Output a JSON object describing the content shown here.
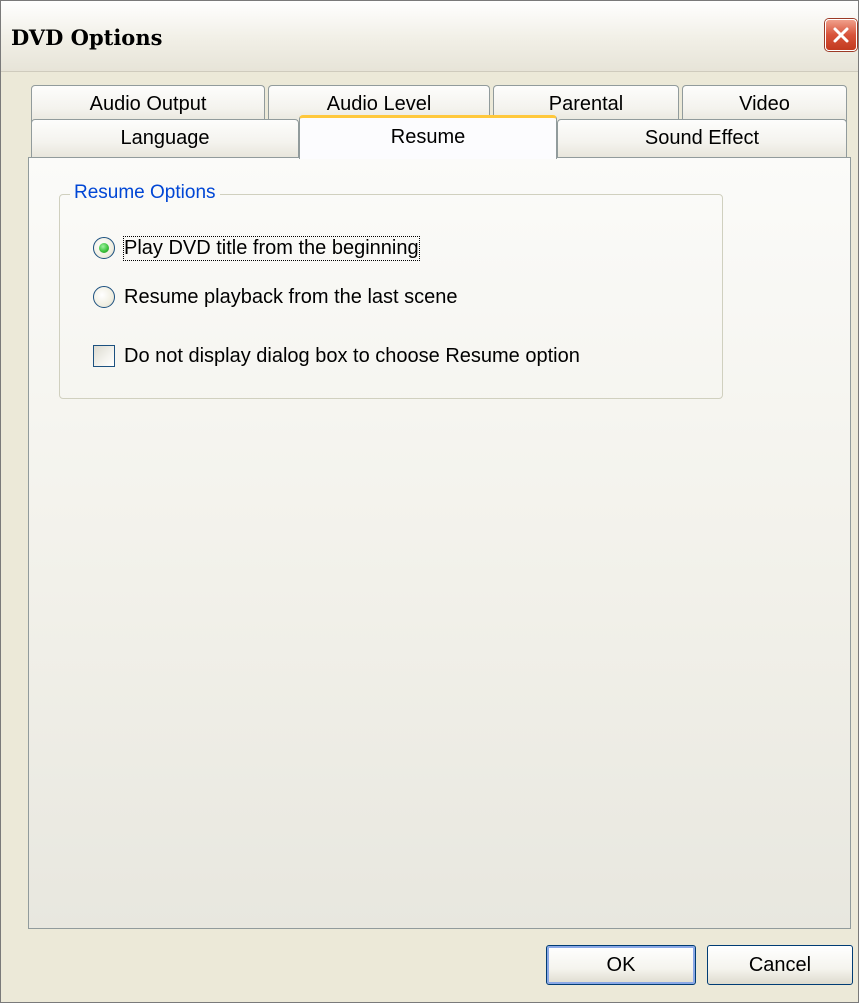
{
  "window": {
    "title": "DVD Options",
    "close_icon": "close-icon"
  },
  "tabs": {
    "row1": [
      {
        "label": "Audio Output"
      },
      {
        "label": "Audio Level"
      },
      {
        "label": "Parental"
      },
      {
        "label": "Video"
      }
    ],
    "row2": [
      {
        "label": "Language"
      },
      {
        "label": "Resume",
        "active": true
      },
      {
        "label": "Sound Effect"
      }
    ]
  },
  "resume_options": {
    "legend": "Resume Options",
    "radio_beginning_label": "Play DVD title from the beginning",
    "radio_beginning_checked": true,
    "radio_last_scene_label": "Resume playback from the last scene",
    "radio_last_scene_checked": false,
    "checkbox_no_dialog_label": "Do not display dialog box to choose Resume option",
    "checkbox_no_dialog_checked": false
  },
  "buttons": {
    "ok_label": "OK",
    "cancel_label": "Cancel"
  },
  "colors": {
    "accent": "#0046d5",
    "active_tab_highlight": "#ffc83c",
    "close_button": "#d8533a",
    "radio_selected": "#3ec33e"
  }
}
